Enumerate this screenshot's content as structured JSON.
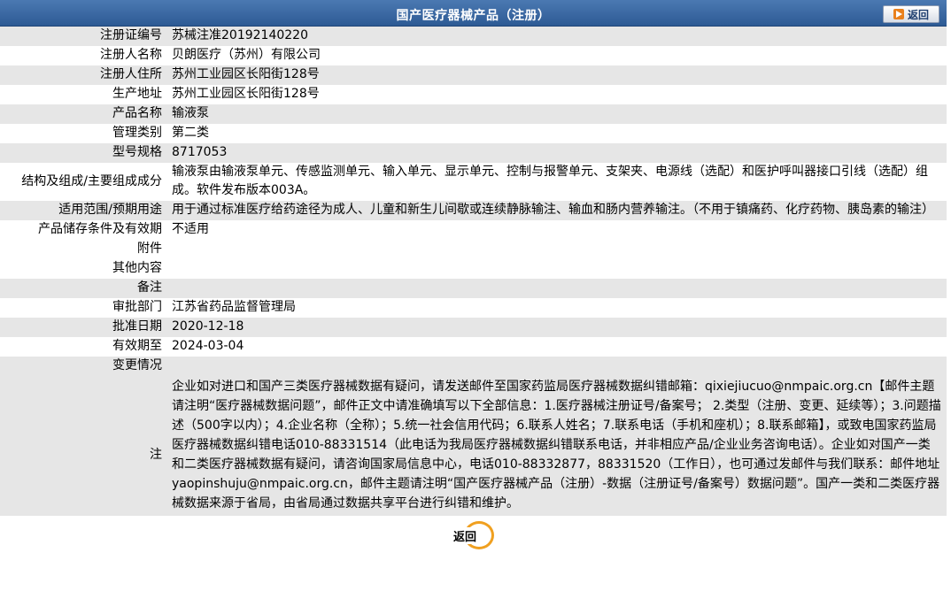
{
  "header": {
    "title": "国产医疗器械产品（注册）",
    "back_label": "返回"
  },
  "fields": [
    {
      "label": "注册证编号",
      "value": "苏械注准20192140220"
    },
    {
      "label": "注册人名称",
      "value": "贝朗医疗（苏州）有限公司"
    },
    {
      "label": "注册人住所",
      "value": "苏州工业园区长阳街128号"
    },
    {
      "label": "生产地址",
      "value": "苏州工业园区长阳街128号"
    },
    {
      "label": "产品名称",
      "value": "输液泵"
    },
    {
      "label": "管理类别",
      "value": "第二类"
    },
    {
      "label": "型号规格",
      "value": "8717053"
    },
    {
      "label": "结构及组成/主要组成成分",
      "value": "输液泵由输液泵单元、传感监测单元、输入单元、显示单元、控制与报警单元、支架夹、电源线（选配）和医护呼叫器接口引线（选配）组成。软件发布版本003A。"
    },
    {
      "label": "适用范围/预期用途",
      "value": "用于通过标准医疗给药途径为成人、儿童和新生儿间歇或连续静脉输注、输血和肠内营养输注。（不用于镇痛药、化疗药物、胰岛素的输注）"
    },
    {
      "label": "产品储存条件及有效期",
      "value": "不适用"
    },
    {
      "label": "附件",
      "value": ""
    },
    {
      "label": "其他内容",
      "value": ""
    },
    {
      "label": "备注",
      "value": ""
    },
    {
      "label": "审批部门",
      "value": "江苏省药品监督管理局"
    },
    {
      "label": "批准日期",
      "value": "2020-12-18"
    },
    {
      "label": "有效期至",
      "value": "2024-03-04"
    },
    {
      "label": "变更情况",
      "value": ""
    }
  ],
  "note": {
    "label": "注",
    "text": "企业如对进口和国产三类医疗器械数据有疑问，请发送邮件至国家药监局医疗器械数据纠错邮箱：qixiejiucuo@nmpaic.org.cn【邮件主题请注明“医疗器械数据问题”，邮件正文中请准确填写以下全部信息：1.医疗器械注册证号/备案号； 2.类型（注册、变更、延续等）；3.问题描述（500字以内）；4.企业名称（全称）；5.统一社会信用代码；6.联系人姓名；7.联系电话（手机和座机）；8.联系邮箱】，或致电国家药监局医疗器械数据纠错电话010-88331514（此电话为我局医疗器械数据纠错联系电话，并非相应产品/企业业务咨询电话）。企业如对国产一类和二类医疗器械数据有疑问，请咨询国家局信息中心，电话010-88332877，88331520（工作日），也可通过发邮件与我们联系：邮件地址yaopinshuju@nmpaic.org.cn，邮件主题请注明“国产医疗器械产品（注册）-数据（注册证号/备案号）数据问题”。国产一类和二类医疗器械数据来源于省局，由省局通过数据共享平台进行纠错和维护。"
  },
  "footer": {
    "back_label": "返回"
  },
  "colors": {
    "header_bg": "#2d5a94",
    "row_gray": "#e6e6e6",
    "row_white": "#ffffff",
    "back_accent": "#f0a020"
  }
}
